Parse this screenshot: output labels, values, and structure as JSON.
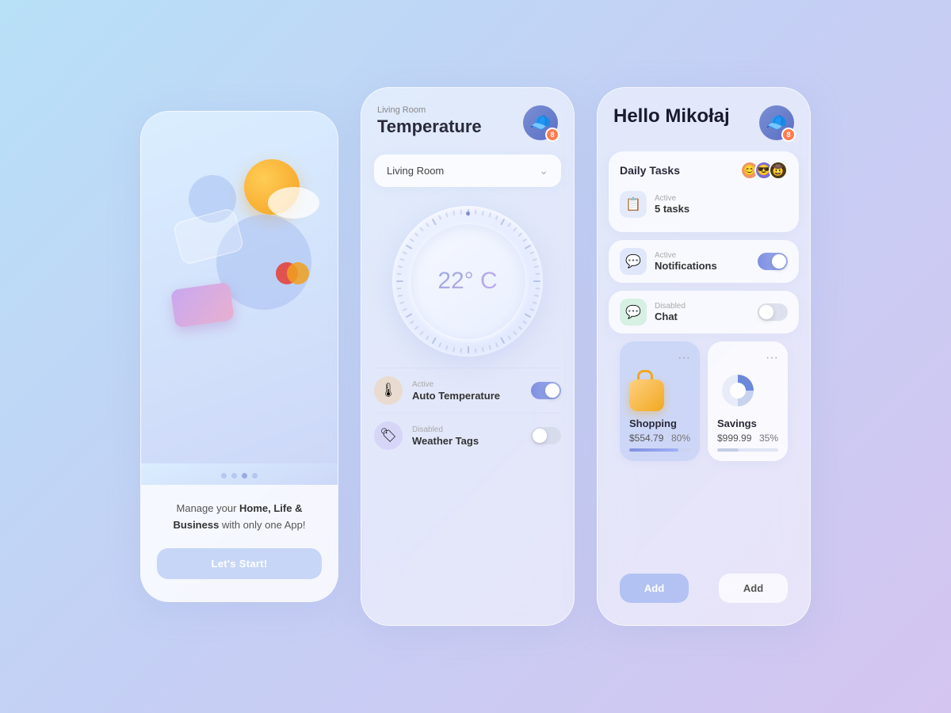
{
  "card1": {
    "tagline_start": "Manage your ",
    "tagline_bold": "Home, Life & Business",
    "tagline_end": " with only one App!",
    "tagline_full": "Manage your Home, Life & Business with only one App!",
    "btn_label": "Let's Start!"
  },
  "card2": {
    "room_label": "Living Room",
    "title": "Temperature",
    "dropdown_value": "Living Room",
    "temperature": "22° C",
    "badge_count": "8",
    "auto_temp": {
      "status": "Active",
      "name": "Auto Temperature",
      "enabled": true
    },
    "weather_tags": {
      "status": "Disabled",
      "name": "Weather Tags",
      "enabled": false
    }
  },
  "card3": {
    "greeting": "Hello Mikołaj",
    "badge_count": "8",
    "daily_tasks": {
      "title": "Daily Tasks",
      "status": "Active",
      "count": "5 tasks"
    },
    "notifications": {
      "status": "Active",
      "name": "Notifications",
      "enabled": true
    },
    "chat": {
      "status": "Disabled",
      "name": "Chat",
      "enabled": false
    },
    "shopping": {
      "name": "Shopping",
      "amount": "$554.79",
      "percent": "80%",
      "fill_percent": 80,
      "dots": "⋯"
    },
    "savings": {
      "name": "Savings",
      "amount": "$999.99",
      "percent": "35%",
      "fill_percent": 35,
      "dots": "⋯"
    },
    "add_btn_label": "Add"
  }
}
